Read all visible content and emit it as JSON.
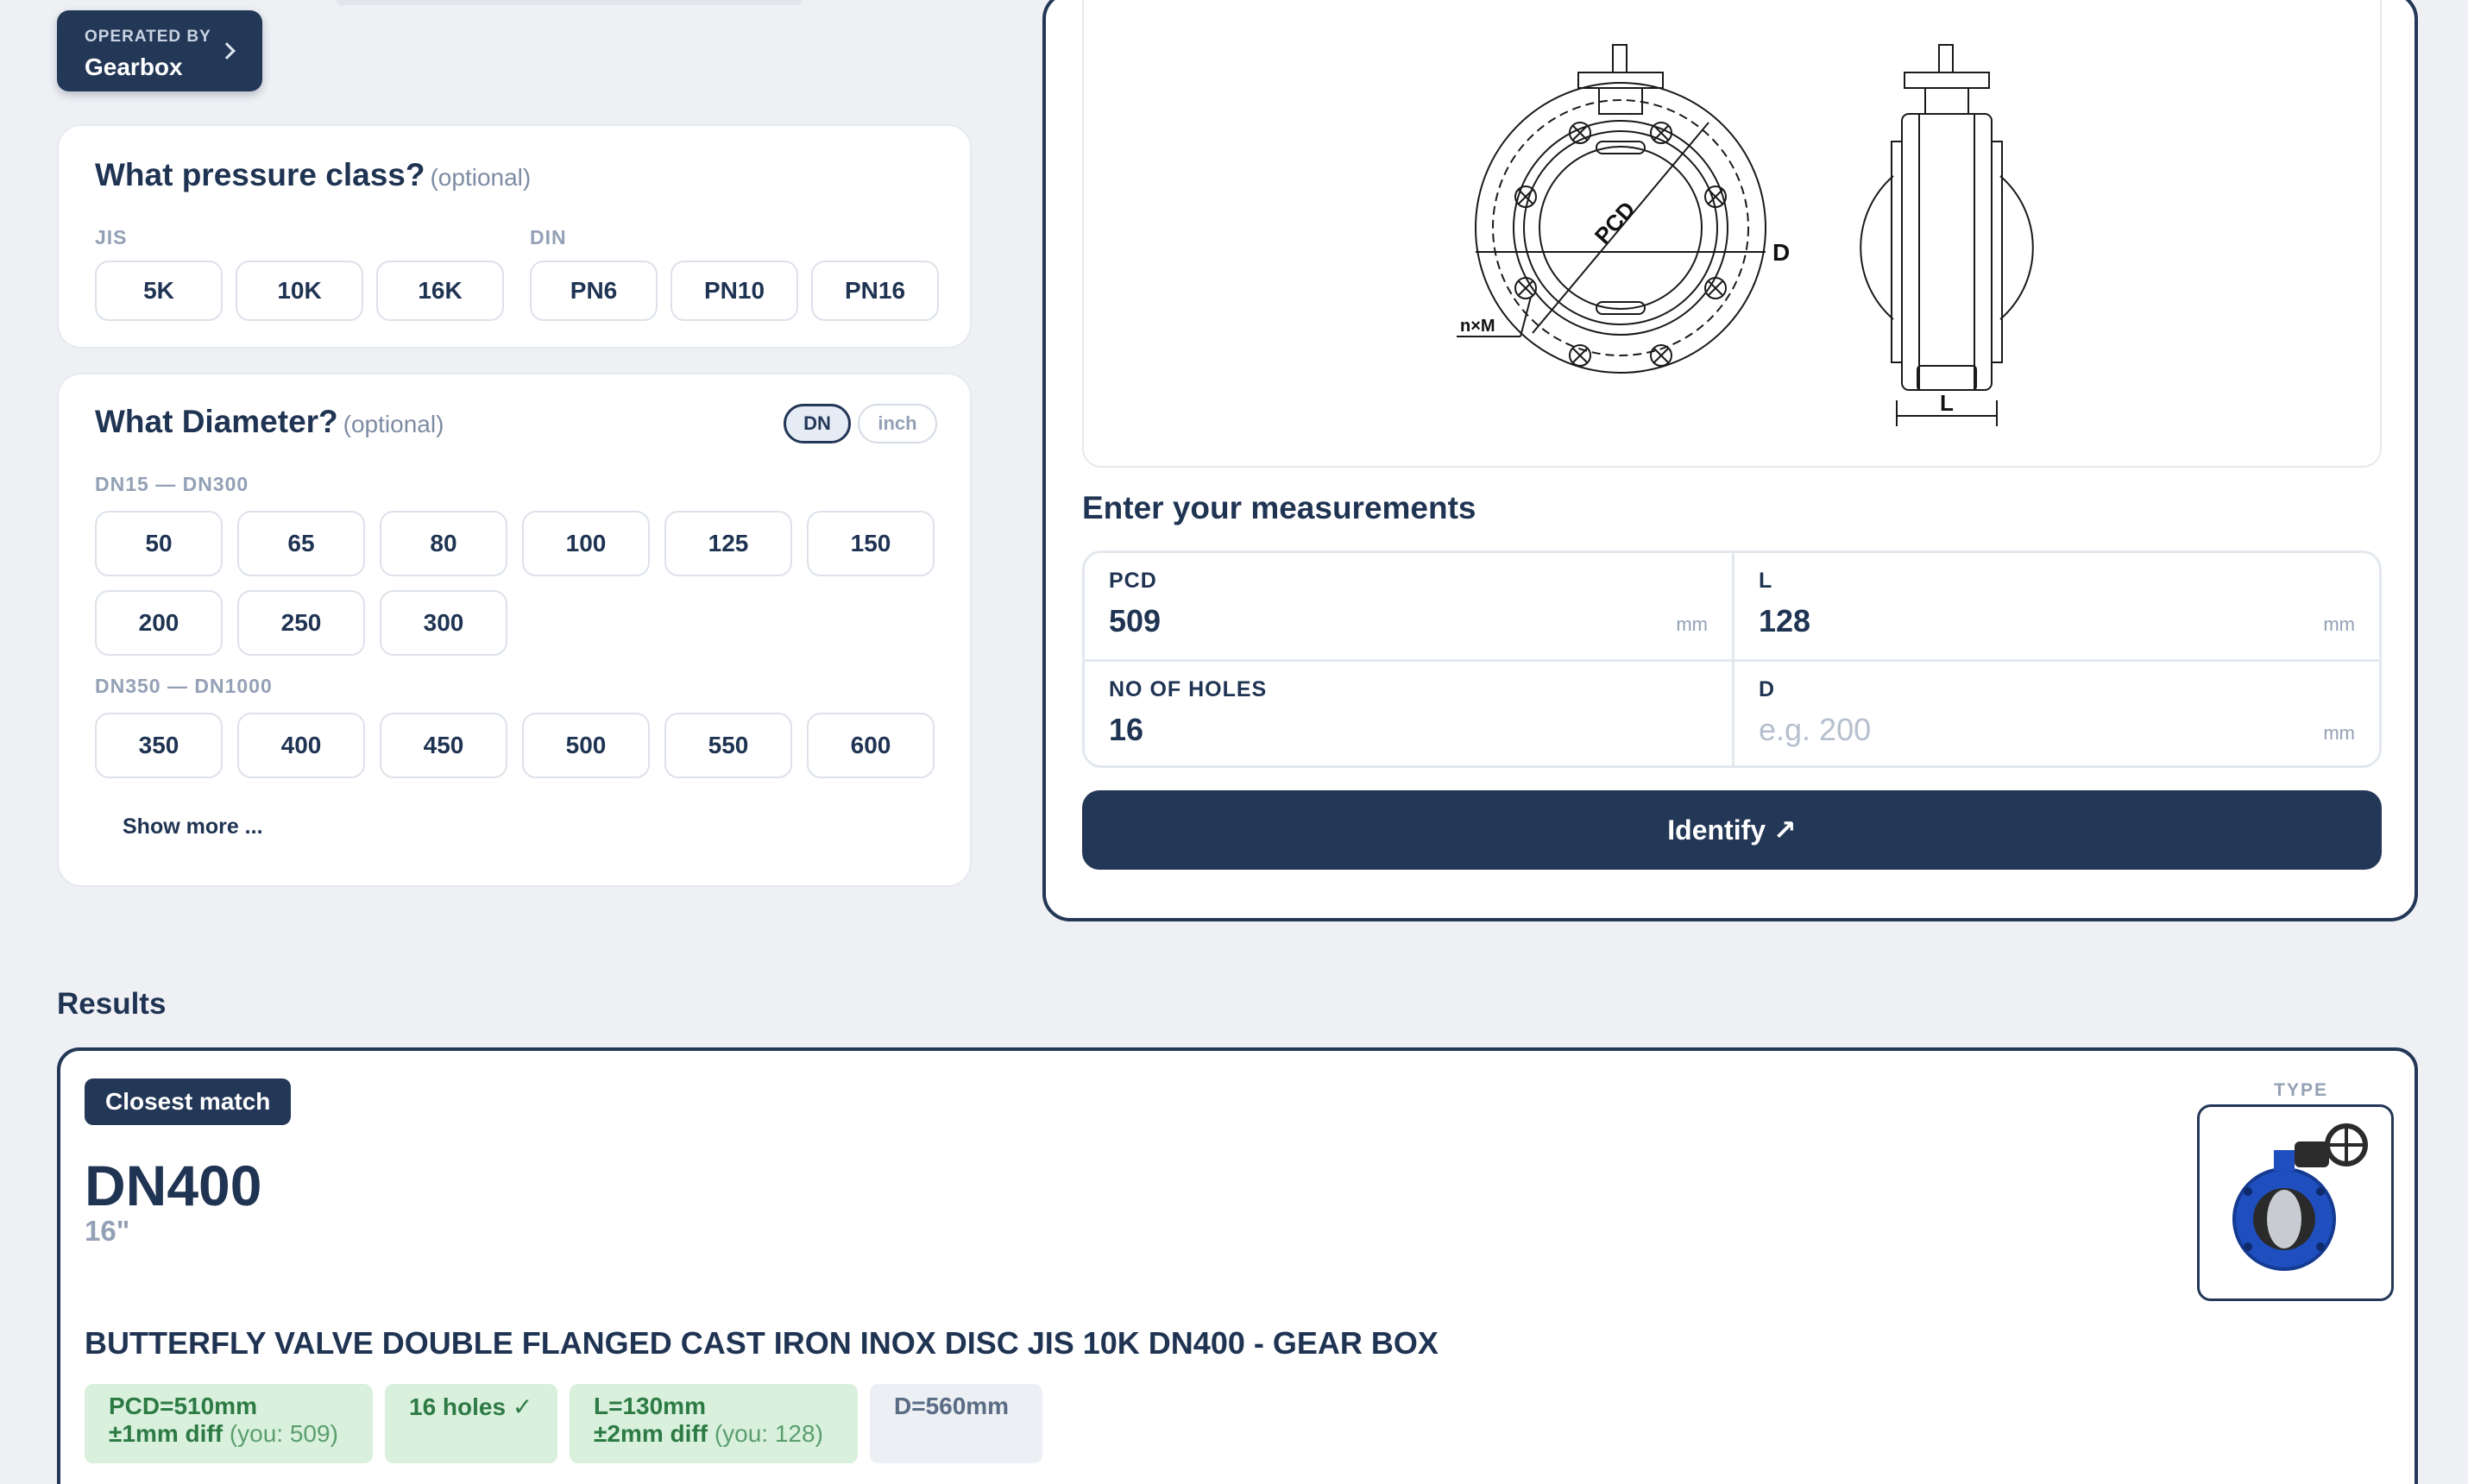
{
  "operated_by": {
    "label": "OPERATED BY",
    "name": "Gearbox",
    "icon": "chevron-right-icon"
  },
  "pressure": {
    "title": "What pressure class?",
    "optional": "(optional)",
    "groups": [
      {
        "label": "JIS",
        "options": [
          "5K",
          "10K",
          "16K"
        ]
      },
      {
        "label": "DIN",
        "options": [
          "PN6",
          "PN10",
          "PN16"
        ]
      }
    ]
  },
  "diameter": {
    "title": "What Diameter?",
    "optional": "(optional)",
    "unit_options": [
      "DN",
      "inch"
    ],
    "unit_selected": "DN",
    "range1_label": "DN15 — DN300",
    "range1": [
      "50",
      "65",
      "80",
      "100",
      "125",
      "150",
      "200",
      "250",
      "300"
    ],
    "range2_label": "DN350 — DN1000",
    "range2": [
      "350",
      "400",
      "450",
      "500",
      "550",
      "600"
    ],
    "show_more": "Show more ..."
  },
  "diagram": {
    "labels": {
      "pcd": "PCD",
      "d": "D",
      "nxm": "n×M",
      "l": "L"
    }
  },
  "measurements": {
    "title": "Enter your measurements",
    "fields": {
      "pcd": {
        "label": "PCD",
        "value": "509",
        "unit": "mm"
      },
      "l": {
        "label": "L",
        "value": "128",
        "unit": "mm"
      },
      "holes": {
        "label": "NO OF HOLES",
        "value": "16"
      },
      "d": {
        "label": "D",
        "placeholder": "e.g. 200",
        "unit": "mm"
      }
    },
    "identify_label": "Identify ↗"
  },
  "results": {
    "title": "Results",
    "badge": "Closest match",
    "dn": "DN400",
    "inch": "16\"",
    "type_label": "TYPE",
    "product_name": "BUTTERFLY VALVE DOUBLE FLANGED CAST IRON INOX DISC JIS 10K DN400 - GEAR BOX",
    "tags": {
      "pcd": {
        "line1": "PCD=510mm",
        "line2": "±1mm diff",
        "you": "(you: 509)"
      },
      "holes": {
        "line1": "16 holes ✓"
      },
      "l": {
        "line1": "L=130mm",
        "line2": "±2mm diff",
        "you": "(you: 128)"
      },
      "d": {
        "line1": "D=560mm"
      }
    }
  },
  "colors": {
    "navy": "#233757",
    "bg": "#eef0f4",
    "match_green_bg": "#d8f0dc",
    "match_green_text": "#2d7a44",
    "valve_blue": "#1f4fbf"
  }
}
